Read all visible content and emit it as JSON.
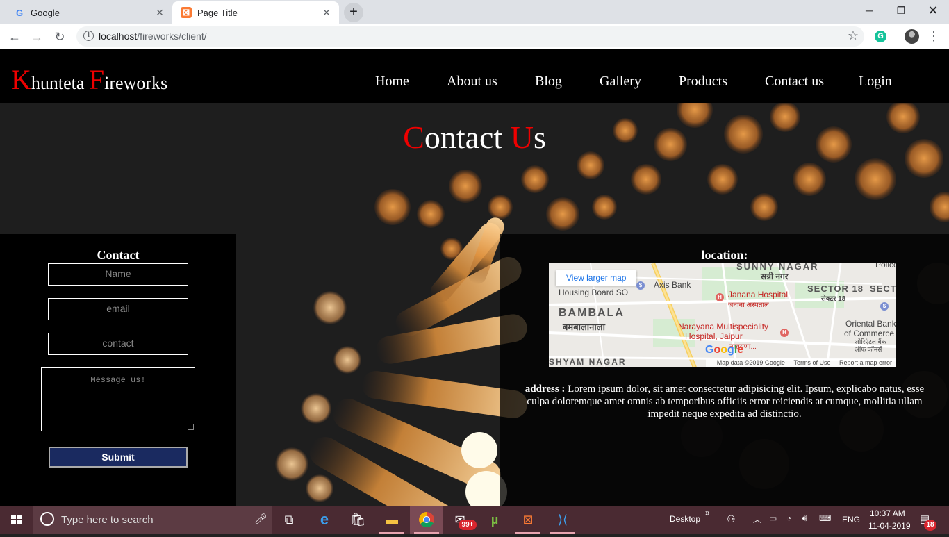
{
  "browser": {
    "tabs": [
      {
        "title": "Google",
        "active": false,
        "icon": "google-favicon"
      },
      {
        "title": "Page Title",
        "active": true,
        "icon": "xampp-favicon"
      }
    ],
    "url_host": "localhost",
    "url_path": "/fireworks/client/"
  },
  "site": {
    "logo_first_cap": "K",
    "logo_first_rest": "hunteta ",
    "logo_second_cap": "F",
    "logo_second_rest": "ireworks",
    "nav": [
      "Home",
      "About us",
      "Blog",
      "Gallery",
      "Products",
      "Contact us",
      "Login"
    ]
  },
  "heading": {
    "cap1": "C",
    "rest1": "ontact ",
    "cap2": "U",
    "rest2": "s"
  },
  "contact_form": {
    "title": "Contact",
    "name_placeholder": "Name",
    "email_placeholder": "email",
    "contact_placeholder": "contact",
    "message_placeholder": "Message us!",
    "submit_label": "Submit"
  },
  "location": {
    "title": "location:",
    "map": {
      "view_larger": "View larger map",
      "labels": {
        "sunny_nagar": "SUNNY NAGAR",
        "sunny_nagar_hi": "सन्नी नगर",
        "police": "Police",
        "axis_bank": "Axis Bank",
        "housing_board": "Housing Board SO",
        "janana": "Janana Hospital",
        "janana_hi": "जनाना अस्पताल",
        "sector18": "SECTOR 18",
        "sector18_hi": "सेक्टर 18",
        "secto": "SECTO",
        "bambala": "BAMBALA",
        "bambala_hi": "बमबालानाला",
        "narayana1": "Narayana Multispeciality",
        "narayana2": "Hospital, Jaipur",
        "narayana_hi": "नारायणा...",
        "oriental1": "Oriental Bank",
        "oriental2": "of Commerce",
        "oriental_hi1": "ओरिएंटल बैंक",
        "oriental_hi2": "ऑफ कॉमर्स",
        "shyam_nagar": "SHYAM NAGAR",
        "google": "Google",
        "map_data": "Map data ©2019 Google",
        "terms": "Terms of Use",
        "report": "Report a map error"
      }
    },
    "address_label": "address :",
    "address_text": "Lorem ipsum dolor, sit amet consectetur adipisicing elit. Ipsum, explicabo natus, esse culpa doloremque amet omnis ab temporibus officiis error reiciendis at cumque, mollitia ullam impedit neque expedita ad distinctio."
  },
  "taskbar": {
    "search_placeholder": "Type here to search",
    "desktop_label": "Desktop",
    "language": "ENG",
    "time": "10:37 AM",
    "date": "11-04-2019",
    "mail_badge": "99+",
    "notification_count": "18"
  },
  "colors": {
    "accent_red": "#ee0000",
    "submit_bg": "#1a2a60",
    "taskbar_bg": "#4a2a32"
  }
}
